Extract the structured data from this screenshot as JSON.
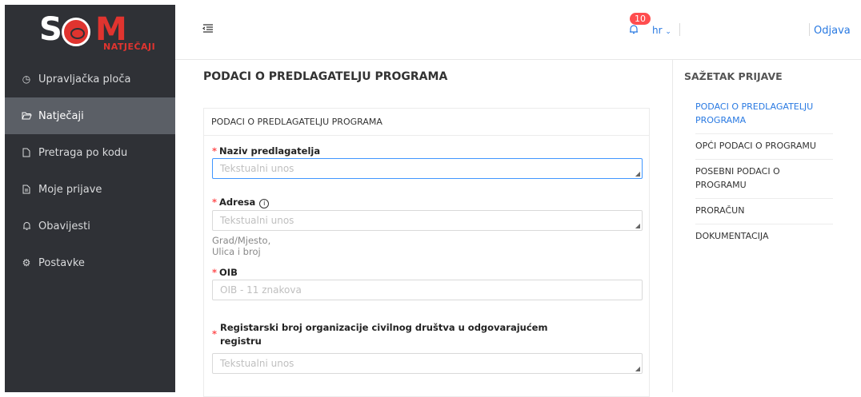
{
  "logo": {
    "main": "S",
    "m": "M",
    "sub": "NATJEČAJI"
  },
  "sidebar": {
    "items": [
      {
        "label": "Upravljačka ploča",
        "icon": "dashboard-icon"
      },
      {
        "label": "Natječaji",
        "icon": "folder-open-icon"
      },
      {
        "label": "Pretraga po kodu",
        "icon": "file-icon"
      },
      {
        "label": "Moje prijave",
        "icon": "file-text-icon"
      },
      {
        "label": "Obavijesti",
        "icon": "bell-icon"
      },
      {
        "label": "Postavke",
        "icon": "gear-icon"
      }
    ]
  },
  "header": {
    "notification_count": "10",
    "language": "hr",
    "logout": "Odjava"
  },
  "main": {
    "page_title": "PODACI O PREDLAGATELJU PROGRAMA",
    "card_title": "PODACI O PREDLAGATELJU PROGRAMA",
    "fields": [
      {
        "label": "Naziv predlagatelja",
        "placeholder": "Tekstualni unos"
      },
      {
        "label": "Adresa",
        "placeholder": "Tekstualni unos",
        "help": "Grad/Mjesto, Ulica i broj"
      },
      {
        "label": "OIB",
        "placeholder": "OIB - 11 znakova"
      },
      {
        "label_line1": "Registarski broj organizacije civilnog društva u odgovarajućem",
        "label_line2": "registru",
        "placeholder": "Tekstualni unos"
      }
    ]
  },
  "summary": {
    "title": "SAŽETAK PRIJAVE",
    "items": [
      {
        "label": "PODACI O PREDLAGATELJU PROGRAMA",
        "active": true
      },
      {
        "label": "OPĆI PODACI O PROGRAMU",
        "active": false
      },
      {
        "label": "POSEBNI PODACI O PROGRAMU",
        "active": false
      },
      {
        "label": "PRORAČUN",
        "active": false
      },
      {
        "label": "DOKUMENTACIJA",
        "active": false
      }
    ]
  },
  "colors": {
    "accent": "#2a7ae2",
    "sidebar_bg": "#2f3136",
    "required": "#ff4d4f",
    "brand_red": "#e0342f"
  }
}
